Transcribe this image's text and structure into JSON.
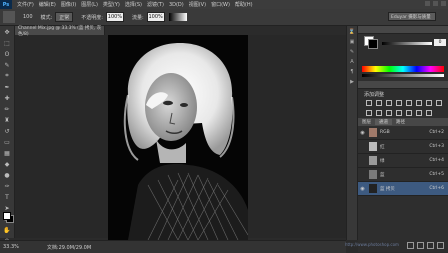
{
  "app": {
    "logo": "Ps"
  },
  "menu": [
    "文件(F)",
    "编辑(E)",
    "图像(I)",
    "图层(L)",
    "类型(Y)",
    "选择(S)",
    "滤镜(T)",
    "3D(D)",
    "视图(V)",
    "窗口(W)",
    "帮助(H)"
  ],
  "options": {
    "brush_size": "100",
    "mode_label": "模式:",
    "mode_value": "正常",
    "opacity_label": "不透明度:",
    "opacity_value": "100%",
    "flow_label": "流量:",
    "flow_value": "100%"
  },
  "workspace": {
    "selected": "Eduyar 摄影与质量"
  },
  "document": {
    "tab_title": "Channel Mix.jpg @ 33.3% (蓝 拷贝, 灰色/8)"
  },
  "status": {
    "zoom": "33.3%",
    "doc_info": "文档:29.0M/29.0M"
  },
  "color_panel": {
    "slider_value": "0"
  },
  "adjustments": {
    "title": "添加调整"
  },
  "channels_panel": {
    "tabs": [
      "图层",
      "通道",
      "路径"
    ],
    "rows": [
      {
        "name": "RGB",
        "shortcut": "Ctrl+2",
        "visible": true
      },
      {
        "name": "红",
        "shortcut": "Ctrl+3",
        "visible": false
      },
      {
        "name": "绿",
        "shortcut": "Ctrl+4",
        "visible": false
      },
      {
        "name": "蓝",
        "shortcut": "Ctrl+5",
        "visible": false
      },
      {
        "name": "蓝 拷贝",
        "shortcut": "Ctrl+6",
        "visible": true
      }
    ]
  },
  "watermark": "http://www.photoshop.com"
}
